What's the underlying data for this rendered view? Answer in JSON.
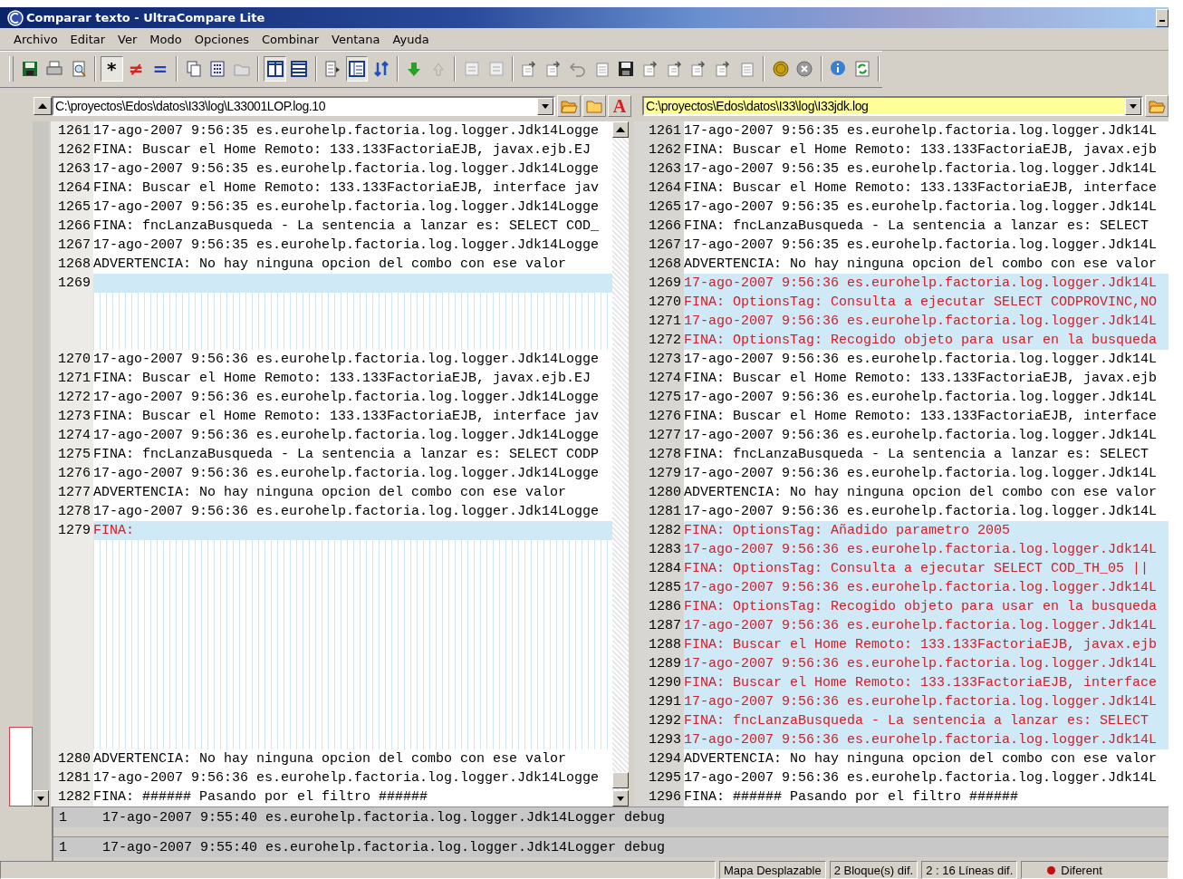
{
  "window": {
    "title": "Comparar texto - UltraCompare Lite"
  },
  "menu": [
    "Archivo",
    "Editar",
    "Ver",
    "Modo",
    "Opciones",
    "Combinar",
    "Ventana",
    "Ayuda"
  ],
  "toolbar": {
    "glyph_buttons": [
      {
        "text": "*",
        "selected": true,
        "color": "#000000"
      },
      {
        "text": "≠",
        "selected": false,
        "color": "#e02020"
      },
      {
        "text": "=",
        "selected": false,
        "color": "#2040c0"
      }
    ]
  },
  "panes": [
    {
      "path": "C:\\proyectos\\Edos\\datos\\I33\\log\\L33001LOP.log.10",
      "active": false,
      "font_button": "A",
      "lines": [
        {
          "kind": "line",
          "num": "1261",
          "text": "17-ago-2007 9:56:35 es.eurohelp.factoria.log.logger.Jdk14Logge",
          "diff": false
        },
        {
          "kind": "line",
          "num": "1262",
          "text": "FINA: Buscar el Home Remoto: 133.133FactoriaEJB, javax.ejb.EJ",
          "diff": false
        },
        {
          "kind": "line",
          "num": "1263",
          "text": "17-ago-2007 9:56:35 es.eurohelp.factoria.log.logger.Jdk14Logge",
          "diff": false
        },
        {
          "kind": "line",
          "num": "1264",
          "text": "FINA: Buscar el Home Remoto: 133.133FactoriaEJB, interface jav",
          "diff": false
        },
        {
          "kind": "line",
          "num": "1265",
          "text": "17-ago-2007 9:56:35 es.eurohelp.factoria.log.logger.Jdk14Logge",
          "diff": false
        },
        {
          "kind": "line",
          "num": "1266",
          "text": "FINA: fncLanzaBusqueda - La sentencia a lanzar es: SELECT COD_",
          "diff": false
        },
        {
          "kind": "line",
          "num": "1267",
          "text": "17-ago-2007 9:56:35 es.eurohelp.factoria.log.logger.Jdk14Logge",
          "diff": false
        },
        {
          "kind": "line",
          "num": "1268",
          "text": "ADVERTENCIA: No hay ninguna opcion del combo con ese valor",
          "diff": false
        },
        {
          "kind": "line",
          "num": "1269",
          "diff": true
        },
        {
          "kind": "gap"
        },
        {
          "kind": "gap"
        },
        {
          "kind": "gap"
        },
        {
          "kind": "line",
          "num": "1270",
          "text": "17-ago-2007 9:56:36 es.eurohelp.factoria.log.logger.Jdk14Logge",
          "diff": false
        },
        {
          "kind": "line",
          "num": "1271",
          "text": "FINA: Buscar el Home Remoto: 133.133FactoriaEJB, javax.ejb.EJ",
          "diff": false
        },
        {
          "kind": "line",
          "num": "1272",
          "text": "17-ago-2007 9:56:36 es.eurohelp.factoria.log.logger.Jdk14Logge",
          "diff": false
        },
        {
          "kind": "line",
          "num": "1273",
          "text": "FINA: Buscar el Home Remoto: 133.133FactoriaEJB, interface jav",
          "diff": false
        },
        {
          "kind": "line",
          "num": "1274",
          "text": "17-ago-2007 9:56:36 es.eurohelp.factoria.log.logger.Jdk14Logge",
          "diff": false
        },
        {
          "kind": "line",
          "num": "1275",
          "text": "FINA: fncLanzaBusqueda - La sentencia a lanzar es: SELECT CODP",
          "diff": false
        },
        {
          "kind": "line",
          "num": "1276",
          "text": "17-ago-2007 9:56:36 es.eurohelp.factoria.log.logger.Jdk14Logge",
          "diff": false
        },
        {
          "kind": "line",
          "num": "1277",
          "text": "ADVERTENCIA: No hay ninguna opcion del combo con ese valor",
          "diff": false
        },
        {
          "kind": "line",
          "num": "1278",
          "text": "17-ago-2007 9:56:36 es.eurohelp.factoria.log.logger.Jdk14Logge",
          "diff": false
        },
        {
          "kind": "line",
          "num": "1279",
          "text": "FINA:",
          "diff": true
        },
        {
          "kind": "gap"
        },
        {
          "kind": "gap"
        },
        {
          "kind": "gap"
        },
        {
          "kind": "gap"
        },
        {
          "kind": "gap"
        },
        {
          "kind": "gap"
        },
        {
          "kind": "gap"
        },
        {
          "kind": "gap"
        },
        {
          "kind": "gap"
        },
        {
          "kind": "gap"
        },
        {
          "kind": "gap"
        },
        {
          "kind": "line",
          "num": "1280",
          "text": "ADVERTENCIA: No hay ninguna opcion del combo con ese valor",
          "diff": false
        },
        {
          "kind": "line",
          "num": "1281",
          "text": "17-ago-2007 9:56:36 es.eurohelp.factoria.log.logger.Jdk14Logge",
          "diff": false
        },
        {
          "kind": "line",
          "num": "1282",
          "text": "FINA: ###### Pasando por el filtro ######",
          "diff": false
        }
      ]
    },
    {
      "path": "C:\\proyectos\\Edos\\datos\\I33\\log\\I33jdk.log",
      "active": true,
      "lines": [
        {
          "kind": "line",
          "num": "1261",
          "text": "17-ago-2007 9:56:35 es.eurohelp.factoria.log.logger.Jdk14L",
          "diff": false
        },
        {
          "kind": "line",
          "num": "1262",
          "text": "FINA: Buscar el Home Remoto: 133.133FactoriaEJB, javax.ejb",
          "diff": false
        },
        {
          "kind": "line",
          "num": "1263",
          "text": "17-ago-2007 9:56:35 es.eurohelp.factoria.log.logger.Jdk14L",
          "diff": false
        },
        {
          "kind": "line",
          "num": "1264",
          "text": "FINA: Buscar el Home Remoto: 133.133FactoriaEJB, interface",
          "diff": false
        },
        {
          "kind": "line",
          "num": "1265",
          "text": "17-ago-2007 9:56:35 es.eurohelp.factoria.log.logger.Jdk14L",
          "diff": false
        },
        {
          "kind": "line",
          "num": "1266",
          "text": "FINA: fncLanzaBusqueda - La sentencia a lanzar es: SELECT",
          "diff": false
        },
        {
          "kind": "line",
          "num": "1267",
          "text": "17-ago-2007 9:56:35 es.eurohelp.factoria.log.logger.Jdk14L",
          "diff": false
        },
        {
          "kind": "line",
          "num": "1268",
          "text": "ADVERTENCIA: No hay ninguna opcion del combo con ese valor",
          "diff": false
        },
        {
          "kind": "line",
          "num": "1269",
          "text": "17-ago-2007 9:56:36 es.eurohelp.factoria.log.logger.Jdk14L",
          "diff": true
        },
        {
          "kind": "line",
          "num": "1270",
          "text": "FINA: OptionsTag: Consulta a ejecutar SELECT CODPROVINC,NO",
          "diff": true
        },
        {
          "kind": "line",
          "num": "1271",
          "text": "17-ago-2007 9:56:36 es.eurohelp.factoria.log.logger.Jdk14L",
          "diff": true
        },
        {
          "kind": "line",
          "num": "1272",
          "text": "FINA: OptionsTag: Recogido objeto para usar en la busqueda",
          "diff": true
        },
        {
          "kind": "line",
          "num": "1273",
          "text": "17-ago-2007 9:56:36 es.eurohelp.factoria.log.logger.Jdk14L",
          "diff": false
        },
        {
          "kind": "line",
          "num": "1274",
          "text": "FINA: Buscar el Home Remoto: 133.133FactoriaEJB, javax.ejb",
          "diff": false
        },
        {
          "kind": "line",
          "num": "1275",
          "text": "17-ago-2007 9:56:36 es.eurohelp.factoria.log.logger.Jdk14L",
          "diff": false
        },
        {
          "kind": "line",
          "num": "1276",
          "text": "FINA: Buscar el Home Remoto: 133.133FactoriaEJB, interface",
          "diff": false
        },
        {
          "kind": "line",
          "num": "1277",
          "text": "17-ago-2007 9:56:36 es.eurohelp.factoria.log.logger.Jdk14L",
          "diff": false
        },
        {
          "kind": "line",
          "num": "1278",
          "text": "FINA: fncLanzaBusqueda - La sentencia a lanzar es: SELECT",
          "diff": false
        },
        {
          "kind": "line",
          "num": "1279",
          "text": "17-ago-2007 9:56:36 es.eurohelp.factoria.log.logger.Jdk14L",
          "diff": false
        },
        {
          "kind": "line",
          "num": "1280",
          "text": "ADVERTENCIA: No hay ninguna opcion del combo con ese valor",
          "diff": false
        },
        {
          "kind": "line",
          "num": "1281",
          "text": "17-ago-2007 9:56:36 es.eurohelp.factoria.log.logger.Jdk14L",
          "diff": false
        },
        {
          "kind": "line",
          "num": "1282",
          "text": "FINA: OptionsTag: Añadido parametro 2005",
          "diff": true
        },
        {
          "kind": "line",
          "num": "1283",
          "text": "17-ago-2007 9:56:36 es.eurohelp.factoria.log.logger.Jdk14L",
          "diff": true
        },
        {
          "kind": "line",
          "num": "1284",
          "text": "FINA: OptionsTag: Consulta a ejecutar SELECT COD_TH_05 ||",
          "diff": true
        },
        {
          "kind": "line",
          "num": "1285",
          "text": "17-ago-2007 9:56:36 es.eurohelp.factoria.log.logger.Jdk14L",
          "diff": true
        },
        {
          "kind": "line",
          "num": "1286",
          "text": "FINA: OptionsTag: Recogido objeto para usar en la busqueda",
          "diff": true
        },
        {
          "kind": "line",
          "num": "1287",
          "text": "17-ago-2007 9:56:36 es.eurohelp.factoria.log.logger.Jdk14L",
          "diff": true
        },
        {
          "kind": "line",
          "num": "1288",
          "text": "FINA: Buscar el Home Remoto: 133.133FactoriaEJB, javax.ejb",
          "diff": true
        },
        {
          "kind": "line",
          "num": "1289",
          "text": "17-ago-2007 9:56:36 es.eurohelp.factoria.log.logger.Jdk14L",
          "diff": true
        },
        {
          "kind": "line",
          "num": "1290",
          "text": "FINA: Buscar el Home Remoto: 133.133FactoriaEJB, interface",
          "diff": true
        },
        {
          "kind": "line",
          "num": "1291",
          "text": "17-ago-2007 9:56:36 es.eurohelp.factoria.log.logger.Jdk14L",
          "diff": true
        },
        {
          "kind": "line",
          "num": "1292",
          "text": "FINA: fncLanzaBusqueda - La sentencia a lanzar es: SELECT",
          "diff": true
        },
        {
          "kind": "line",
          "num": "1293",
          "text": "17-ago-2007 9:56:36 es.eurohelp.factoria.log.logger.Jdk14L",
          "diff": true
        },
        {
          "kind": "line",
          "num": "1294",
          "text": "ADVERTENCIA: No hay ninguna opcion del combo con ese valor",
          "diff": false
        },
        {
          "kind": "line",
          "num": "1295",
          "text": "17-ago-2007 9:56:36 es.eurohelp.factoria.log.logger.Jdk14L",
          "diff": false
        },
        {
          "kind": "line",
          "num": "1296",
          "text": "FINA: ###### Pasando por el filtro ######",
          "diff": false
        }
      ]
    }
  ],
  "detail_lines": [
    {
      "num": "1",
      "text": "17-ago-2007 9:55:40 es.eurohelp.factoria.log.logger.Jdk14Logger debug"
    },
    {
      "num": "1",
      "text": "17-ago-2007 9:55:40 es.eurohelp.factoria.log.logger.Jdk14Logger debug"
    }
  ],
  "status_bar": [
    {
      "kind": "plain",
      "text": "Mapa Desplazable"
    },
    {
      "kind": "plain",
      "text": "2 Bloque(s) dif."
    },
    {
      "kind": "plain",
      "text": "2 : 16 Líneas dif."
    },
    {
      "kind": "indicator",
      "text": "Diferent",
      "color": "#c01010"
    }
  ]
}
